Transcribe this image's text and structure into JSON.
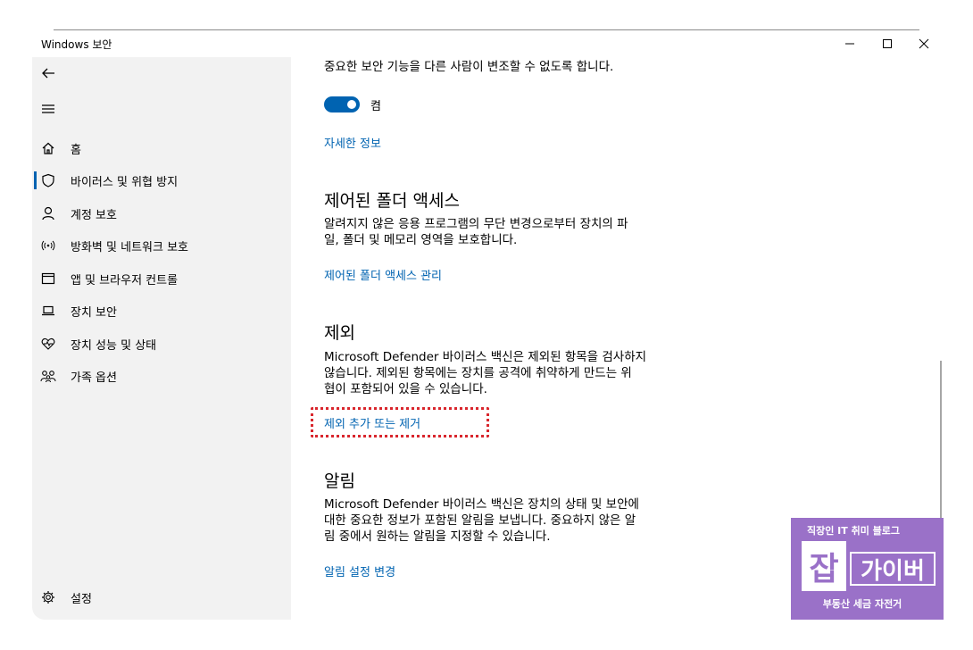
{
  "window": {
    "title": "Windows 보안"
  },
  "sidebar": {
    "items": [
      {
        "label": "홈",
        "icon": "home-icon"
      },
      {
        "label": "바이러스 및 위협 방지",
        "icon": "shield-icon",
        "active": true
      },
      {
        "label": "계정 보호",
        "icon": "person-icon"
      },
      {
        "label": "방화벽 및 네트워크 보호",
        "icon": "wifi-antenna-icon"
      },
      {
        "label": "앱 및 브라우저 컨트롤",
        "icon": "app-window-icon"
      },
      {
        "label": "장치 보안",
        "icon": "laptop-icon"
      },
      {
        "label": "장치 성능 및 상태",
        "icon": "heart-pulse-icon"
      },
      {
        "label": "가족 옵션",
        "icon": "family-icon"
      }
    ],
    "settings_label": "설정"
  },
  "main": {
    "tamper": {
      "description": "중요한 보안 기능을 다른 사람이 변조할 수 없도록 합니다.",
      "toggle_label": "켬",
      "toggle_on": true,
      "more_info": "자세한 정보"
    },
    "folder_access": {
      "heading": "제어된 폴더 액세스",
      "desc_line1": "알려지지 않은 응용 프로그램의 무단 변경으로부터 장치의 파",
      "desc_line2": "일, 폴더 및 메모리 영역을 보호합니다.",
      "link": "제어된 폴더 액세스 관리"
    },
    "exclusions": {
      "heading": "제외",
      "desc_line1": "Microsoft Defender 바이러스 백신은 제외된 항목을 검사하지",
      "desc_line2": "않습니다. 제외된 항목에는 장치를 공격에 취약하게 만드는 위",
      "desc_line3": "협이 포함되어 있을 수 있습니다.",
      "link": "제외 추가 또는 제거"
    },
    "notifications": {
      "heading": "알림",
      "desc_line1": "Microsoft Defender 바이러스 백신은 장치의 상태 및 보안에",
      "desc_line2": "대한 중요한 정보가 포함된 알림을 보냅니다. 중요하지 않은 알",
      "desc_line3": "림 중에서 원하는 알림을 지정할 수 있습니다.",
      "link": "알림 설정 변경"
    }
  },
  "watermark": {
    "line1": "직장인 IT 취미 블로그",
    "mark": "잡",
    "name": "가이버",
    "line3": "부동산 세금 자전거"
  },
  "colors": {
    "accent": "#0063b1",
    "highlight": "#d9262d",
    "sidebar_bg": "#f2f2f2",
    "badge": "#9a71c8"
  }
}
